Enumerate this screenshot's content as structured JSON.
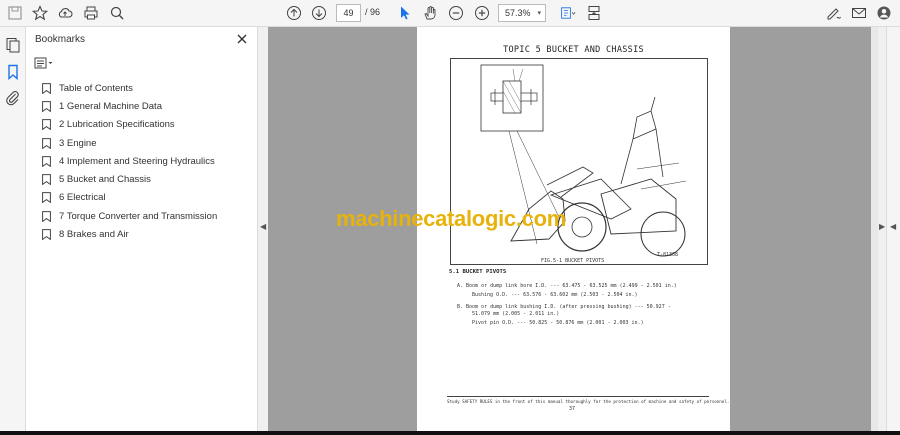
{
  "toolbar": {
    "page_current": "49",
    "page_total": "/ 96",
    "zoom": "57.3%"
  },
  "panel": {
    "title": "Bookmarks",
    "items": [
      {
        "label": "Table of Contents"
      },
      {
        "label": "1 General Machine Data"
      },
      {
        "label": "2 Lubrication Specifications"
      },
      {
        "label": "3 Engine"
      },
      {
        "label": "4 Implement and Steering Hydraulics"
      },
      {
        "label": "5 Bucket and Chassis"
      },
      {
        "label": "6 Electrical"
      },
      {
        "label": "7 Torque Converter and Transmission"
      },
      {
        "label": "8 Brakes and Air"
      }
    ]
  },
  "document": {
    "title": "TOPIC 5 BUCKET AND CHASSIS",
    "figure_caption": "FIG.5-1  BUCKET PIVOTS",
    "figure_code": "T-81368",
    "section_heading": "5.1 BUCKET PIVOTS",
    "lines": [
      "A.   Boom or dump link bore I.D. --- 63.475 - 63.525 mm (2.499 - 2.501 in.)",
      "Bushing O.D. --- 63.576 - 63.602 mm (2.503 - 2.504 in.)",
      "B.   Boom or dump link bushing I.D. (after pressing bushing) --- 50.927 -",
      "51.079 mm (2.005 - 2.011 in.)",
      "Pivot pin O.D. --- 50.825 - 50.876 mm (2.001 - 2.003 in.)"
    ],
    "footer": "Study SAFETY RULES in the front of this manual thoroughly for the protection of machine and safety of personnel.",
    "page_number": "37"
  },
  "watermark": "machinecatalogic.com",
  "colors": {
    "watermark": "#e8b20c",
    "viewer_bg": "#9e9e9e",
    "active_icon": "#1a73e8"
  }
}
